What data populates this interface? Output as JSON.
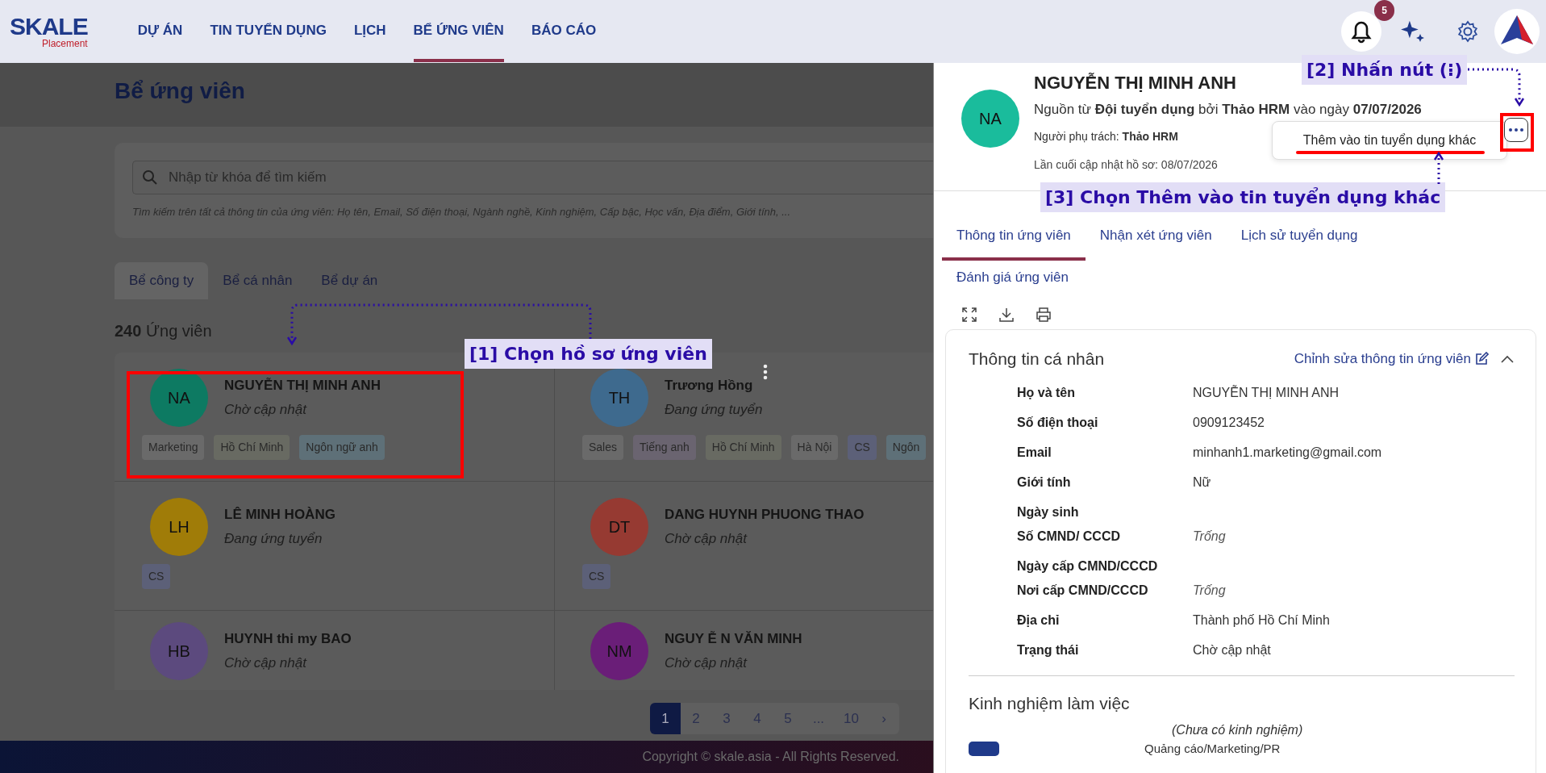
{
  "header": {
    "logo": {
      "text": "SKALE",
      "subtitle": "Placement"
    },
    "nav": [
      {
        "label": "DỰ ÁN",
        "selected": false
      },
      {
        "label": "TIN TUYỂN DỤNG",
        "selected": false
      },
      {
        "label": "LỊCH",
        "selected": false
      },
      {
        "label": "BỂ ỨNG VIÊN",
        "selected": true
      },
      {
        "label": "BÁO CÁO",
        "selected": false
      }
    ],
    "notifications": "5"
  },
  "page": {
    "title": "Bể ứng viên",
    "search": {
      "placeholder": "Nhập từ khóa để tìm kiếm",
      "hint": "Tìm kiếm trên tất cả thông tin của ứng viên: Họ tên, Email, Số điện thoại, Ngành nghề, Kinh nghiệm, Cấp bậc, Học vấn, Địa điểm, Giới tính, ..."
    },
    "tabs": [
      {
        "label": "Bể công ty",
        "selected": true
      },
      {
        "label": "Bể cá nhân",
        "selected": false
      },
      {
        "label": "Bể dự án",
        "selected": false
      }
    ],
    "count": "240",
    "count_label": "Ứng viên",
    "candidates": [
      {
        "initials": "NA",
        "color": "#0d7a62",
        "name": "NGUYỄN THỊ MINH ANH",
        "status": "Chờ cập nhật",
        "tags": [
          {
            "text": "Marketing",
            "color": "#6a6a6a"
          },
          {
            "text": "Hồ Chí Minh",
            "color": "#686a62"
          },
          {
            "text": "Ngôn ngữ anh",
            "color": "#5e7078"
          }
        ]
      },
      {
        "initials": "TH",
        "color": "#3e6a8e",
        "name": "Trương Hồng",
        "status": "Đang ứng tuyển",
        "tags": [
          {
            "text": "Sales",
            "color": "#6a6a6a"
          },
          {
            "text": "Tiếng anh",
            "color": "#6a6470"
          },
          {
            "text": "Hồ Chí Minh",
            "color": "#686a62"
          },
          {
            "text": "Hà Nội",
            "color": "#6a6a6a"
          },
          {
            "text": "CS",
            "color": "#5c6078"
          },
          {
            "text": "Ngôn",
            "color": "#5e7078"
          }
        ]
      },
      {
        "initials": "LH",
        "color": "#a07c08",
        "name": "LÊ MINH HOÀNG",
        "status": "Đang ứng tuyển",
        "tags": [
          {
            "text": "CS",
            "color": "#5c6078"
          }
        ]
      },
      {
        "initials": "DT",
        "color": "#963a32",
        "name": "DANG HUYNH PHUONG THAO",
        "status": "Chờ cập nhật",
        "tags": [
          {
            "text": "CS",
            "color": "#5c6078"
          }
        ]
      },
      {
        "initials": "HB",
        "color": "#5c4a7e",
        "name": "HUYNH thi my BAO",
        "status": "Chờ cập nhật"
      },
      {
        "initials": "NM",
        "color": "#6a1e78",
        "name": "NGUY Ễ N VĂN MINH",
        "status": "Chờ cập nhật"
      }
    ],
    "pagination": [
      {
        "label": "1",
        "selected": true
      },
      {
        "label": "2",
        "selected": false
      },
      {
        "label": "3",
        "selected": false
      },
      {
        "label": "4",
        "selected": false
      },
      {
        "label": "5",
        "selected": false
      },
      {
        "label": "...",
        "selected": false
      },
      {
        "label": "10",
        "selected": false
      },
      {
        "label": "›",
        "selected": false
      }
    ],
    "footer": "Copyright © skale.asia - All Rights Reserved."
  },
  "profile": {
    "initials": "NA",
    "name": "NGUYỄN THỊ MINH ANH",
    "source": "Nguồn từ **Đội tuyển dụng** bởi **Thảo HRM** vào ngày **07/07/2026**",
    "owner": "Người phụ trách: **Thảo HRM**",
    "updated": "Lần cuối cập nhật hồ sơ: 08/07/2026",
    "menu": [
      "Thêm vào tin tuyển dụng khác"
    ],
    "tabs": [
      {
        "label": "Thông tin ứng viên",
        "selected": true
      },
      {
        "label": "Nhận xét ứng viên",
        "selected": false
      },
      {
        "label": "Lịch sử tuyển dụng",
        "selected": false
      },
      {
        "label": "Đánh giá ứng viên",
        "selected": false
      }
    ],
    "personal": {
      "title": "Thông tin cá nhân",
      "edit": "Chỉnh sửa thông tin ứng viên",
      "expanded": true,
      "fields": [
        {
          "label": "Họ và tên",
          "value": "NGUYỄN THỊ MINH ANH"
        },
        {
          "label": "Số điện thoại",
          "value": "0909123452"
        },
        {
          "label": "Email",
          "value": "minhanh1.marketing@gmail.com"
        },
        {
          "label": "Giới tính",
          "value": "Nữ"
        },
        {
          "label": "Ngày sinh"
        },
        {
          "label": "Số CMND/ CCCD",
          "value": "Trống",
          "empty": true
        },
        {
          "label": "Ngày cấp CMND/CCCD"
        },
        {
          "label": "Nơi cấp CMND/CCCD",
          "value": "Trống",
          "empty": true
        },
        {
          "label": "Địa chỉ",
          "value": "Thành phố Hồ Chí Minh"
        },
        {
          "label": "Trạng thái",
          "value": "Chờ cập nhật"
        }
      ]
    },
    "experience": {
      "title": "Kinh nghiệm làm việc",
      "note": "(Chưa có kinh nghiệm)",
      "field": "Quảng cáo/Marketing/PR"
    }
  },
  "annotations": [
    {
      "text": "[1] Chọn hồ sơ ứng viên"
    },
    {
      "text": "[2] Nhấn nút (⁝)"
    },
    {
      "text": "[3] Chọn Thêm vào tin tuyển dụng khác"
    }
  ]
}
